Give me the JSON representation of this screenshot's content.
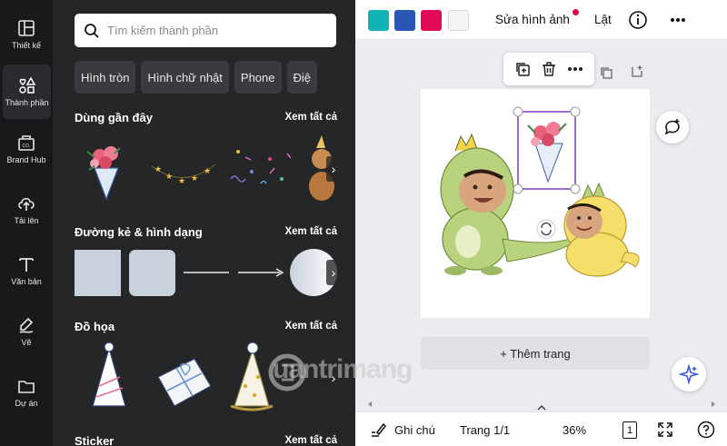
{
  "rail": {
    "items": [
      {
        "label": "Thiết kế",
        "icon": "layout-icon"
      },
      {
        "label": "Thành phần",
        "icon": "shapes-icon"
      },
      {
        "label": "Brand Hub",
        "icon": "brand-hub-icon"
      },
      {
        "label": "Tải lên",
        "icon": "upload-icon"
      },
      {
        "label": "Văn bản",
        "icon": "text-icon"
      },
      {
        "label": "Vẽ",
        "icon": "draw-icon"
      },
      {
        "label": "Dự án",
        "icon": "folder-icon"
      }
    ]
  },
  "panel": {
    "search_placeholder": "Tìm kiếm thành phần",
    "chips": [
      "Hình tròn",
      "Hình chữ nhật",
      "Phone",
      "Điệ"
    ],
    "sections": [
      {
        "title": "Dùng gần đây",
        "see_all": "Xem tất cả"
      },
      {
        "title": "Đường kẻ & hình dạng",
        "see_all": "Xem tất cả"
      },
      {
        "title": "Đồ họa",
        "see_all": "Xem tất cả"
      },
      {
        "title": "Sticker",
        "see_all": "Xem tất cả"
      }
    ]
  },
  "topbar": {
    "colors": [
      "#11b3b4",
      "#2a56b6",
      "#e30a5a",
      "#f3f4f6"
    ],
    "edit_image": "Sửa hình ảnh",
    "flip": "Lật"
  },
  "canvas": {
    "add_page": "+ Thêm trang"
  },
  "bottombar": {
    "notes": "Ghi chú",
    "page": "Trang 1/1",
    "zoom": "36%",
    "page_count": "1"
  },
  "watermark": "uantrimang"
}
